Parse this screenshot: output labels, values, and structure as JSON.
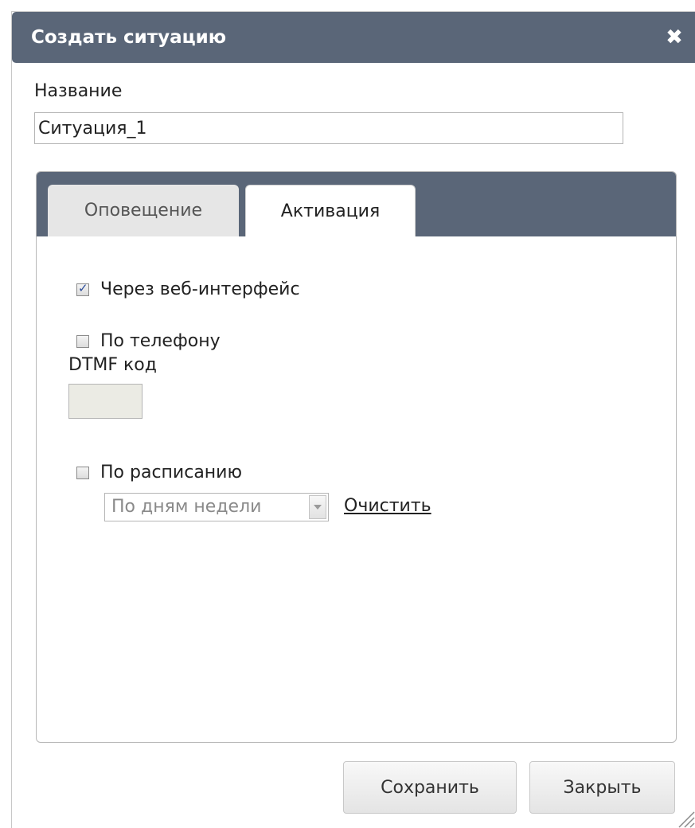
{
  "dialog": {
    "title": "Создать ситуацию",
    "close_icon": "close-icon"
  },
  "name": {
    "label": "Название",
    "value": "Ситуация_1"
  },
  "tabs": [
    {
      "label": "Оповещение",
      "active": false
    },
    {
      "label": "Активация",
      "active": true
    }
  ],
  "activation": {
    "web": {
      "label": "Через веб-интерфейс",
      "checked": true
    },
    "phone": {
      "label": "По телефону",
      "checked": false
    },
    "dtmf": {
      "label": "DTMF код",
      "value": ""
    },
    "schedule": {
      "label": "По расписанию",
      "checked": false,
      "select_value": "По дням недели",
      "clear_label": "Очистить"
    }
  },
  "buttons": {
    "save": "Сохранить",
    "close": "Закрыть"
  },
  "colors": {
    "header": "#5a6678",
    "text": "#222222",
    "disabled_input": "#ebebe4"
  }
}
